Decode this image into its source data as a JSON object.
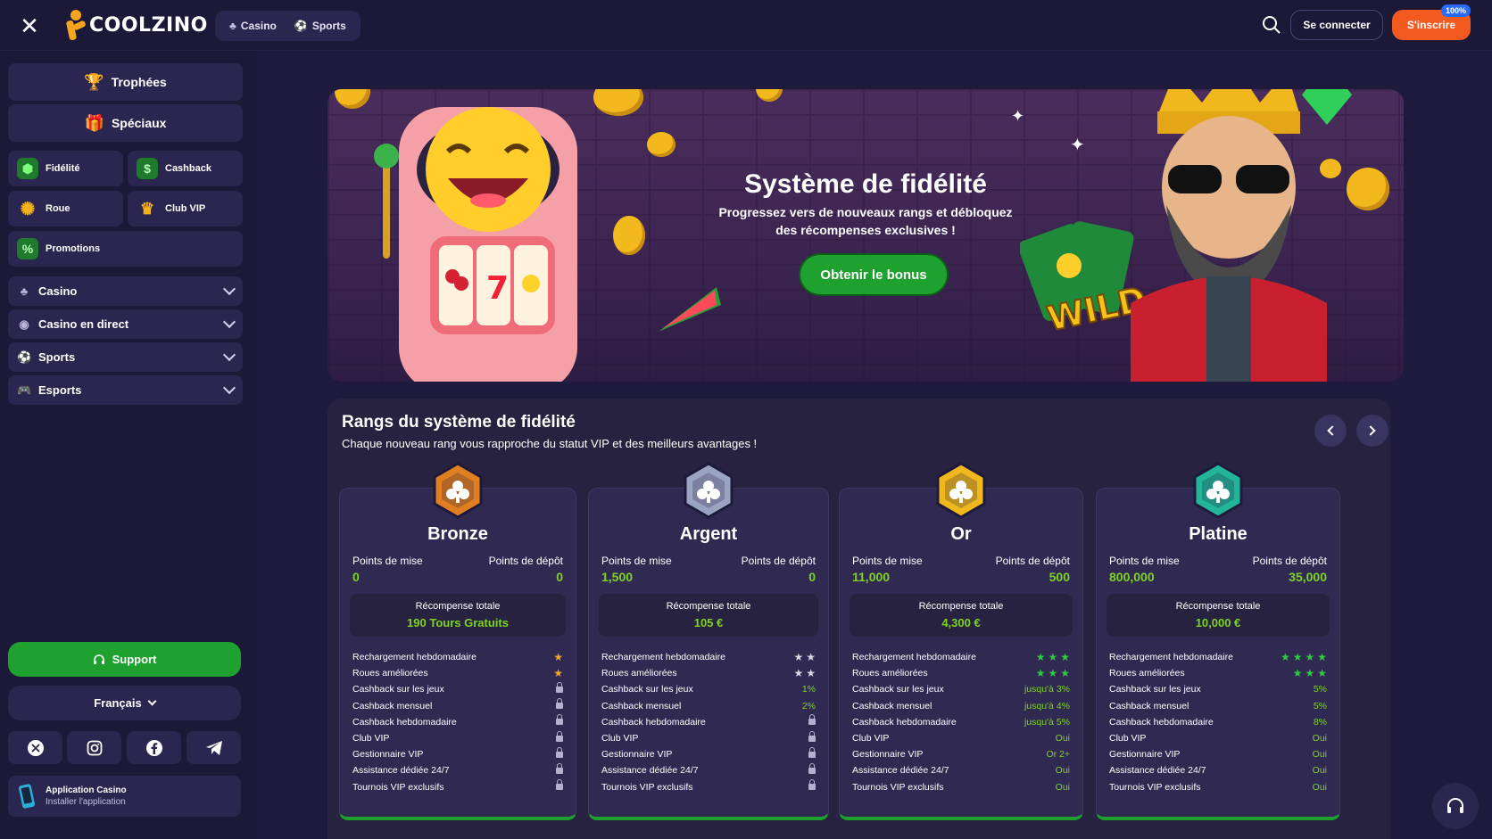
{
  "header": {
    "brand": "COOLZINO",
    "tabs": [
      {
        "label": "Casino",
        "icon": "casino-icon"
      },
      {
        "label": "Sports",
        "icon": "soccer-ball-icon"
      }
    ],
    "login_label": "Se connecter",
    "register_label": "S'inscrire",
    "register_badge": "100%"
  },
  "sidebar": {
    "trophies_label": "Trophées",
    "specials_label": "Spéciaux",
    "grid": [
      {
        "label": "Fidélité",
        "icon": "loyalty-gem-icon"
      },
      {
        "label": "Cashback",
        "icon": "cashback-icon"
      },
      {
        "label": "Roue",
        "icon": "wheel-icon"
      },
      {
        "label": "Club VIP",
        "icon": "crown-icon"
      },
      {
        "label": "Promotions",
        "icon": "promotions-icon"
      }
    ],
    "accordions": [
      {
        "label": "Casino",
        "icon": "casino-icon"
      },
      {
        "label": "Casino en direct",
        "icon": "live-casino-icon"
      },
      {
        "label": "Sports",
        "icon": "soccer-ball-icon"
      },
      {
        "label": "Esports",
        "icon": "gamepad-icon"
      }
    ],
    "support_label": "Support",
    "language_label": "Français",
    "socials": [
      "x-icon",
      "instagram-icon",
      "facebook-icon",
      "telegram-icon"
    ],
    "app": {
      "title": "Application Casino",
      "subtitle": "Installer l'application"
    }
  },
  "banner": {
    "title": "Système de fidélité",
    "subtitle_line1": "Progressez vers de nouveaux rangs et débloquez",
    "subtitle_line2": "des récompenses exclusives !",
    "cta": "Obtenir le bonus"
  },
  "ranks": {
    "title": "Rangs du système de fidélité",
    "subtitle": "Chaque nouveau rang vous rapproche du statut VIP et des meilleurs avantages !",
    "cards": [
      {
        "name": "Bronze",
        "medal_color": "#e07f1f",
        "bet_label": "Points de mise",
        "deposit_label": "Points de dépôt",
        "bet_value": "0",
        "deposit_value": "0",
        "reward_label": "Récompense totale",
        "reward_value": "190 Tours Gratuits",
        "features": [
          {
            "label": "Rechargement hebdomadaire",
            "stars": 1,
            "star_color": "#f5a623"
          },
          {
            "label": "Roues améliorées",
            "stars": 1,
            "star_color": "#f5a623"
          },
          {
            "label": "Cashback sur les jeux",
            "value": ""
          },
          {
            "label": "Cashback mensuel",
            "value": ""
          },
          {
            "label": "Cashback hebdomadaire",
            "value": ""
          },
          {
            "label": "Club VIP",
            "value": ""
          },
          {
            "label": "Gestionnaire VIP",
            "value": ""
          },
          {
            "label": "Assistance dédiée 24/7",
            "value": ""
          },
          {
            "label": "Tournois VIP exclusifs",
            "value": ""
          }
        ]
      },
      {
        "name": "Argent",
        "medal_color": "#9aa3c0",
        "bet_label": "Points de mise",
        "deposit_label": "Points de dépôt",
        "bet_value": "1,500",
        "deposit_value": "0",
        "reward_label": "Récompense totale",
        "reward_value": "105 €",
        "features": [
          {
            "label": "Rechargement hebdomadaire",
            "stars": 2,
            "star_color": "#d9d9e6"
          },
          {
            "label": "Roues améliorées",
            "stars": 2,
            "star_color": "#d9d9e6"
          },
          {
            "label": "Cashback sur les jeux",
            "value": "1%"
          },
          {
            "label": "Cashback mensuel",
            "value": "2%"
          },
          {
            "label": "Cashback hebdomadaire",
            "value": ""
          },
          {
            "label": "Club VIP",
            "value": ""
          },
          {
            "label": "Gestionnaire VIP",
            "value": ""
          },
          {
            "label": "Assistance dédiée 24/7",
            "value": ""
          },
          {
            "label": "Tournois VIP exclusifs",
            "value": ""
          }
        ]
      },
      {
        "name": "Or",
        "medal_color": "#f0b81c",
        "bet_label": "Points de mise",
        "deposit_label": "Points de dépôt",
        "bet_value": "11,000",
        "deposit_value": "500",
        "reward_label": "Récompense totale",
        "reward_value": "4,300 €",
        "features": [
          {
            "label": "Rechargement hebdomadaire",
            "stars": 3,
            "star_color": "#2ecc40"
          },
          {
            "label": "Roues améliorées",
            "stars": 3,
            "star_color": "#2ecc40"
          },
          {
            "label": "Cashback sur les jeux",
            "value": "jusqu'à 3%"
          },
          {
            "label": "Cashback mensuel",
            "value": "jusqu'à 4%"
          },
          {
            "label": "Cashback hebdomadaire",
            "value": "jusqu'à 5%"
          },
          {
            "label": "Club VIP",
            "value": "Oui"
          },
          {
            "label": "Gestionnaire VIP",
            "value": "Or 2+"
          },
          {
            "label": "Assistance dédiée 24/7",
            "value": "Oui"
          },
          {
            "label": "Tournois VIP exclusifs",
            "value": "Oui"
          }
        ]
      },
      {
        "name": "Platine",
        "medal_color": "#23b59a",
        "bet_label": "Points de mise",
        "deposit_label": "Points de dépôt",
        "bet_value": "800,000",
        "deposit_value": "35,000",
        "reward_label": "Récompense totale",
        "reward_value": "10,000 €",
        "features": [
          {
            "label": "Rechargement hebdomadaire",
            "stars": 4,
            "star_color": "#2ecc40"
          },
          {
            "label": "Roues améliorées",
            "stars": 3,
            "star_color": "#2ecc40"
          },
          {
            "label": "Cashback sur les jeux",
            "value": "5%"
          },
          {
            "label": "Cashback mensuel",
            "value": "5%"
          },
          {
            "label": "Cashback hebdomadaire",
            "value": "8%"
          },
          {
            "label": "Club VIP",
            "value": "Oui"
          },
          {
            "label": "Gestionnaire VIP",
            "value": "Oui"
          },
          {
            "label": "Assistance dédiée 24/7",
            "value": "Oui"
          },
          {
            "label": "Tournois VIP exclusifs",
            "value": "Oui"
          }
        ]
      }
    ]
  }
}
